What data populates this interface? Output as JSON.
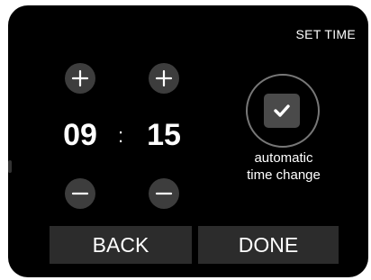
{
  "header": {
    "title": "SET TIME"
  },
  "time": {
    "hour": "09",
    "separator": ":",
    "minute": "15"
  },
  "controls": {
    "increment_icon": "plus-icon",
    "decrement_icon": "minus-icon"
  },
  "automatic": {
    "checked": true,
    "label_line1": "automatic",
    "label_line2": "time change",
    "icon": "checkmark-icon"
  },
  "actions": {
    "back_label": "BACK",
    "done_label": "DONE"
  },
  "colors": {
    "background": "#000000",
    "button": "#3d3d3d",
    "text": "#ffffff"
  }
}
